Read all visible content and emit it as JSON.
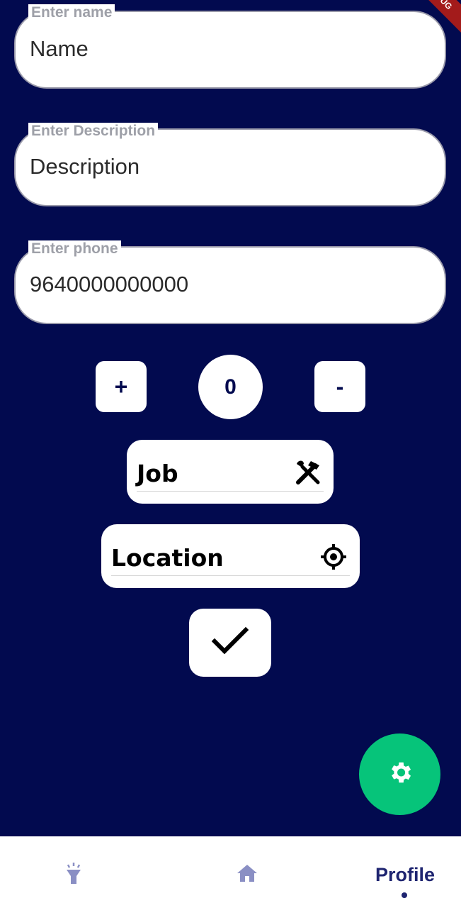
{
  "debug_banner": "DEBUG",
  "form": {
    "name": {
      "label": "Enter name",
      "value": "Name"
    },
    "description": {
      "label": "Enter Description",
      "value": "Description"
    },
    "phone": {
      "label": "Enter phone",
      "value": "9640000000000"
    }
  },
  "counter": {
    "plus_label": "+",
    "value": "0",
    "minus_label": "-"
  },
  "job_button": {
    "label": "Job",
    "icon": "hammer-wrench-icon"
  },
  "location_button": {
    "label": "Location",
    "icon": "gps-target-icon"
  },
  "confirm_button": {
    "icon": "check-icon"
  },
  "fab": {
    "icon": "gear-icon",
    "color": "#06c47a"
  },
  "bottom_nav": {
    "items": [
      {
        "icon": "flashlight-icon"
      },
      {
        "icon": "home-icon"
      },
      {
        "label": "Profile",
        "active": true
      }
    ],
    "color": "#1e2470"
  },
  "colors": {
    "background": "#020a4f",
    "accent_green": "#06c47a"
  }
}
